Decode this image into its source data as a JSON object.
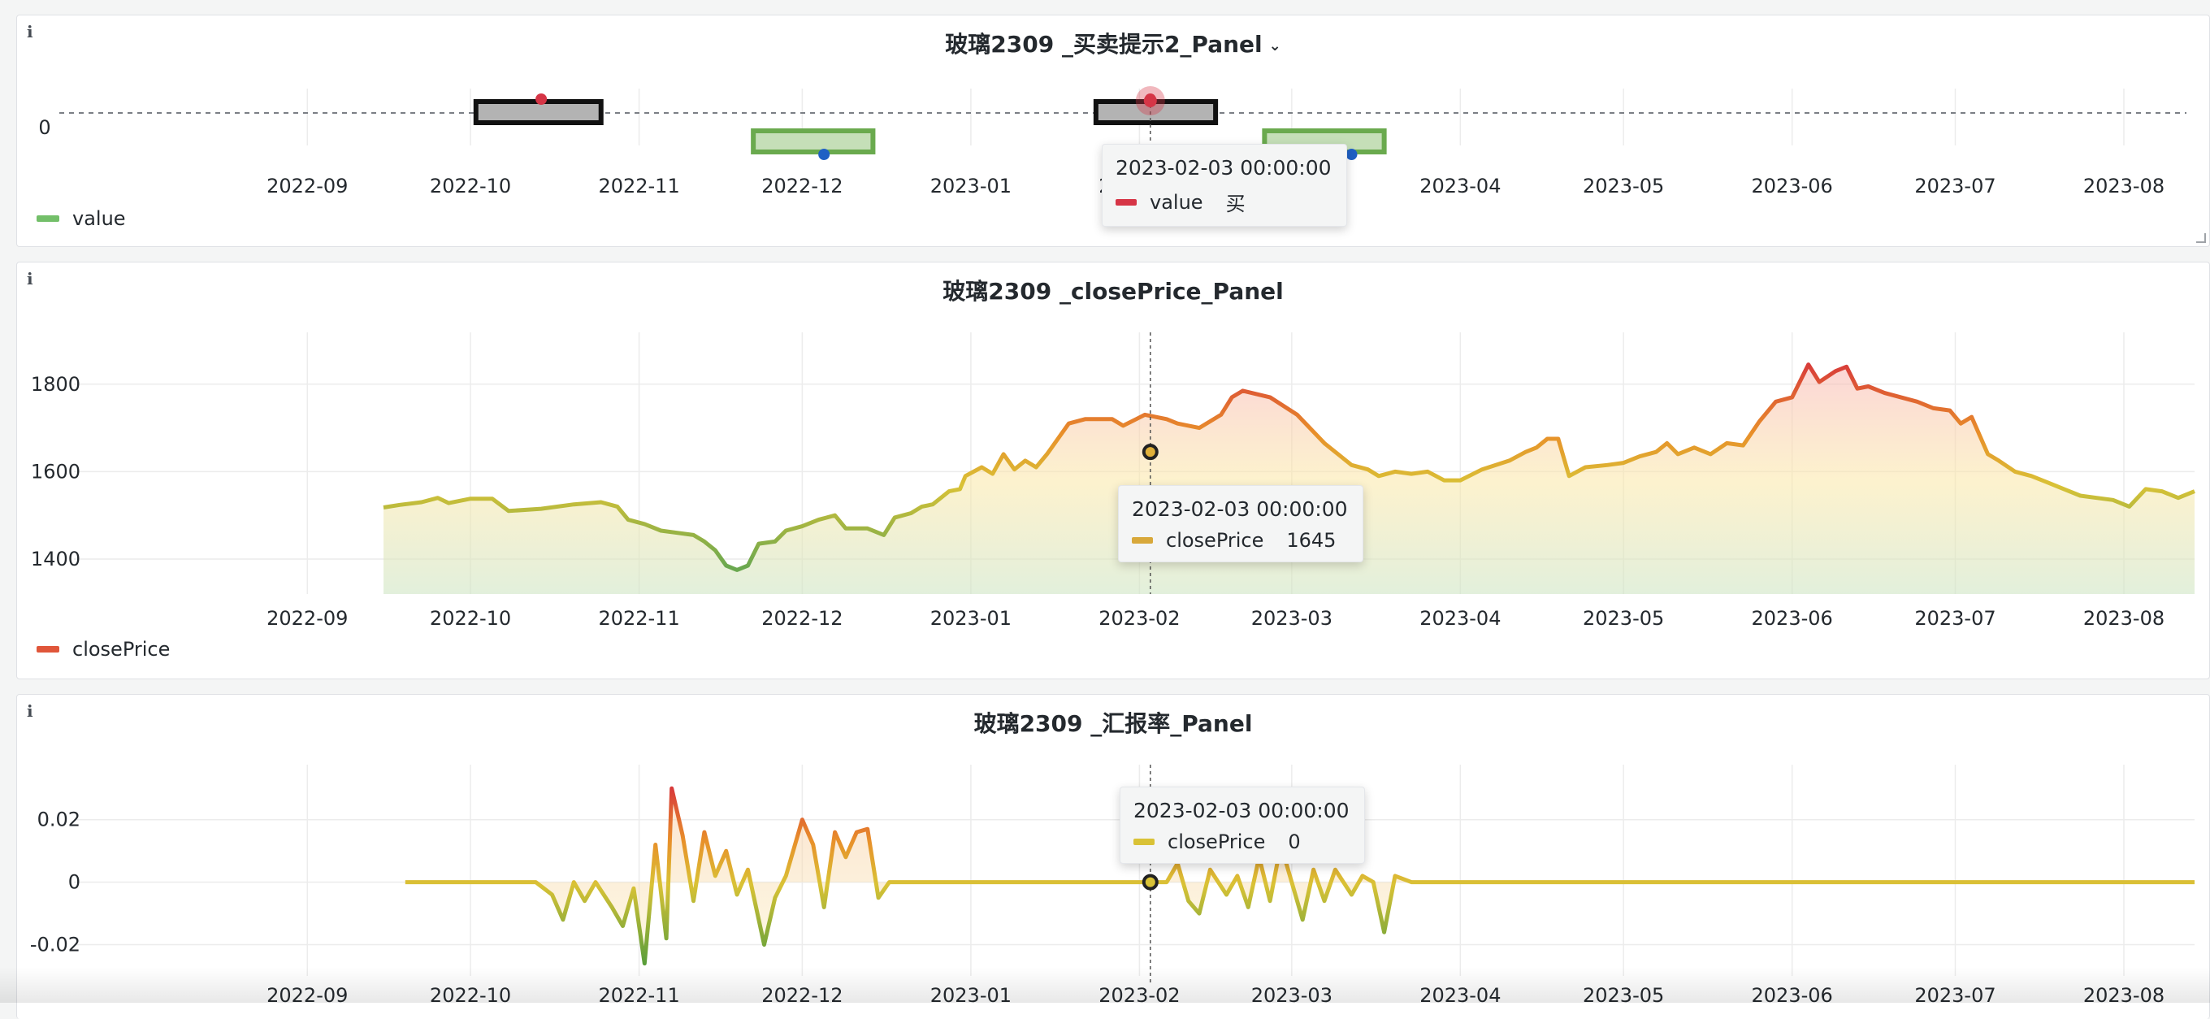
{
  "colors": {
    "buy": "#d63546",
    "sell": "#1f60c4",
    "buy_box": "#111111",
    "sell_box": "#6aaa4e",
    "legend_value": "#73bf69",
    "legend_close": "#e0563a",
    "tooltip_close": "#d8a83a",
    "tooltip_rate": "#d9c236"
  },
  "panels": [
    {
      "title": "玻璃2309 _买卖提示2_Panel",
      "info_icon": "info-icon",
      "chevron_icon": "chevron-down-icon",
      "legend": "value",
      "tooltip": {
        "time": "2023-02-03 00:00:00",
        "series": "value",
        "value": "买"
      }
    },
    {
      "title": "玻璃2309 _closePrice_Panel",
      "info_icon": "info-icon",
      "legend": "closePrice",
      "tooltip": {
        "time": "2023-02-03 00:00:00",
        "series": "closePrice",
        "value": "1645"
      }
    },
    {
      "title": "玻璃2309 _汇报率_Panel",
      "info_icon": "info-icon",
      "tooltip": {
        "time": "2023-02-03 00:00:00",
        "series": "closePrice",
        "value": "0"
      }
    }
  ],
  "chart_data": [
    {
      "type": "scatter",
      "title": "玻璃2309 _买卖提示2_Panel",
      "x_range": [
        "2022-08-10",
        "2023-08-14"
      ],
      "x_ticks": [
        "2022-09",
        "2022-10",
        "2022-11",
        "2022-12",
        "2023-01",
        "2023-02",
        "2023-03",
        "2023-04",
        "2023-05",
        "2023-06",
        "2023-07",
        "2023-08"
      ],
      "y_ticks": [
        "0"
      ],
      "ylim": [
        -1.2,
        1.2
      ],
      "signals": [
        {
          "date": "2022-10-14",
          "value": 1,
          "label": "买",
          "box": [
            "2022-10-02",
            "2022-10-25"
          ]
        },
        {
          "date": "2022-12-05",
          "value": -1,
          "label": "卖",
          "box": [
            "2022-11-22",
            "2022-12-14"
          ]
        },
        {
          "date": "2023-02-03",
          "value": 1,
          "label": "买",
          "box": [
            "2023-01-24",
            "2023-02-15"
          ]
        },
        {
          "date": "2023-03-12",
          "value": -1,
          "label": "卖",
          "box": [
            "2023-02-24",
            "2023-03-18"
          ]
        }
      ],
      "legend": [
        "value"
      ],
      "hover": {
        "date": "2023-02-03",
        "label": "买"
      }
    },
    {
      "type": "area",
      "title": "玻璃2309 _closePrice_Panel",
      "x_range": [
        "2022-08-10",
        "2023-08-14"
      ],
      "x_ticks": [
        "2022-09",
        "2022-10",
        "2022-11",
        "2022-12",
        "2023-01",
        "2023-02",
        "2023-03",
        "2023-04",
        "2023-05",
        "2023-06",
        "2023-07",
        "2023-08"
      ],
      "y_ticks": [
        "1400",
        "1600",
        "1800"
      ],
      "ylim": [
        1320,
        1900
      ],
      "series": [
        {
          "name": "closePrice",
          "points": [
            [
              "2022-09-15",
              1518
            ],
            [
              "2022-09-18",
              1524
            ],
            [
              "2022-09-22",
              1530
            ],
            [
              "2022-09-25",
              1540
            ],
            [
              "2022-09-27",
              1528
            ],
            [
              "2022-10-01",
              1538
            ],
            [
              "2022-10-05",
              1538
            ],
            [
              "2022-10-08",
              1510
            ],
            [
              "2022-10-14",
              1515
            ],
            [
              "2022-10-20",
              1525
            ],
            [
              "2022-10-25",
              1530
            ],
            [
              "2022-10-28",
              1520
            ],
            [
              "2022-10-30",
              1490
            ],
            [
              "2022-11-02",
              1480
            ],
            [
              "2022-11-05",
              1465
            ],
            [
              "2022-11-08",
              1460
            ],
            [
              "2022-11-11",
              1455
            ],
            [
              "2022-11-13",
              1440
            ],
            [
              "2022-11-15",
              1420
            ],
            [
              "2022-11-17",
              1385
            ],
            [
              "2022-11-19",
              1375
            ],
            [
              "2022-11-21",
              1385
            ],
            [
              "2022-11-23",
              1435
            ],
            [
              "2022-11-26",
              1440
            ],
            [
              "2022-11-28",
              1465
            ],
            [
              "2022-12-01",
              1475
            ],
            [
              "2022-12-04",
              1490
            ],
            [
              "2022-12-07",
              1500
            ],
            [
              "2022-12-09",
              1470
            ],
            [
              "2022-12-13",
              1470
            ],
            [
              "2022-12-16",
              1455
            ],
            [
              "2022-12-18",
              1495
            ],
            [
              "2022-12-21",
              1505
            ],
            [
              "2022-12-23",
              1520
            ],
            [
              "2022-12-25",
              1525
            ],
            [
              "2022-12-28",
              1555
            ],
            [
              "2022-12-30",
              1560
            ],
            [
              "2022-12-31",
              1590
            ],
            [
              "2023-01-03",
              1610
            ],
            [
              "2023-01-05",
              1595
            ],
            [
              "2023-01-07",
              1640
            ],
            [
              "2023-01-09",
              1605
            ],
            [
              "2023-01-11",
              1625
            ],
            [
              "2023-01-13",
              1610
            ],
            [
              "2023-01-15",
              1640
            ],
            [
              "2023-01-19",
              1710
            ],
            [
              "2023-01-22",
              1720
            ],
            [
              "2023-01-27",
              1720
            ],
            [
              "2023-01-29",
              1705
            ],
            [
              "2023-02-02",
              1730
            ],
            [
              "2023-02-06",
              1720
            ],
            [
              "2023-02-08",
              1710
            ],
            [
              "2023-02-12",
              1700
            ],
            [
              "2023-02-16",
              1730
            ],
            [
              "2023-02-18",
              1770
            ],
            [
              "2023-02-20",
              1785
            ],
            [
              "2023-02-25",
              1770
            ],
            [
              "2023-03-02",
              1730
            ],
            [
              "2023-03-07",
              1665
            ],
            [
              "2023-03-09",
              1645
            ],
            [
              "2023-03-12",
              1615
            ],
            [
              "2023-03-15",
              1605
            ],
            [
              "2023-03-17",
              1590
            ],
            [
              "2023-03-20",
              1600
            ],
            [
              "2023-03-23",
              1595
            ],
            [
              "2023-03-26",
              1600
            ],
            [
              "2023-03-29",
              1580
            ],
            [
              "2023-04-01",
              1580
            ],
            [
              "2023-04-05",
              1605
            ],
            [
              "2023-04-10",
              1625
            ],
            [
              "2023-04-13",
              1645
            ],
            [
              "2023-04-15",
              1655
            ],
            [
              "2023-04-17",
              1675
            ],
            [
              "2023-04-19",
              1675
            ],
            [
              "2023-04-21",
              1590
            ],
            [
              "2023-04-24",
              1610
            ],
            [
              "2023-04-28",
              1615
            ],
            [
              "2023-05-01",
              1620
            ],
            [
              "2023-05-04",
              1635
            ],
            [
              "2023-05-07",
              1645
            ],
            [
              "2023-05-09",
              1665
            ],
            [
              "2023-05-11",
              1640
            ],
            [
              "2023-05-14",
              1655
            ],
            [
              "2023-05-17",
              1640
            ],
            [
              "2023-05-20",
              1665
            ],
            [
              "2023-05-23",
              1660
            ],
            [
              "2023-05-26",
              1715
            ],
            [
              "2023-05-29",
              1760
            ],
            [
              "2023-06-01",
              1770
            ],
            [
              "2023-06-04",
              1845
            ],
            [
              "2023-06-06",
              1805
            ],
            [
              "2023-06-09",
              1830
            ],
            [
              "2023-06-11",
              1840
            ],
            [
              "2023-06-13",
              1790
            ],
            [
              "2023-06-15",
              1795
            ],
            [
              "2023-06-18",
              1780
            ],
            [
              "2023-06-21",
              1770
            ],
            [
              "2023-06-24",
              1760
            ],
            [
              "2023-06-27",
              1745
            ],
            [
              "2023-06-30",
              1740
            ],
            [
              "2023-07-02",
              1710
            ],
            [
              "2023-07-04",
              1725
            ],
            [
              "2023-07-07",
              1640
            ],
            [
              "2023-07-09",
              1625
            ],
            [
              "2023-07-12",
              1600
            ],
            [
              "2023-07-15",
              1590
            ],
            [
              "2023-07-18",
              1575
            ],
            [
              "2023-07-21",
              1560
            ],
            [
              "2023-07-24",
              1545
            ],
            [
              "2023-07-27",
              1540
            ],
            [
              "2023-07-30",
              1535
            ],
            [
              "2023-08-02",
              1520
            ],
            [
              "2023-08-05",
              1560
            ],
            [
              "2023-08-08",
              1555
            ],
            [
              "2023-08-11",
              1540
            ],
            [
              "2023-08-14",
              1555
            ]
          ]
        }
      ],
      "legend": [
        "closePrice"
      ],
      "hover": {
        "date": "2023-02-03",
        "value": 1645
      }
    },
    {
      "type": "line",
      "title": "玻璃2309 _汇报率_Panel",
      "x_range": [
        "2022-08-10",
        "2023-08-14"
      ],
      "x_ticks": [
        "2022-09",
        "2022-10",
        "2022-11",
        "2022-12",
        "2023-01",
        "2023-02",
        "2023-03",
        "2023-04",
        "2023-05",
        "2023-06",
        "2023-07",
        "2023-08"
      ],
      "y_ticks": [
        "0.02",
        "0",
        "-0.02"
      ],
      "ylim": [
        -0.03,
        0.035
      ],
      "series": [
        {
          "name": "closePrice",
          "points": [
            [
              "2022-09-19",
              0
            ],
            [
              "2022-10-13",
              0
            ],
            [
              "2022-10-16",
              -0.004
            ],
            [
              "2022-10-18",
              -0.012
            ],
            [
              "2022-10-20",
              0
            ],
            [
              "2022-10-22",
              -0.006
            ],
            [
              "2022-10-24",
              0
            ],
            [
              "2022-10-27",
              -0.008
            ],
            [
              "2022-10-29",
              -0.014
            ],
            [
              "2022-10-31",
              -0.002
            ],
            [
              "2022-11-02",
              -0.026
            ],
            [
              "2022-11-04",
              0.012
            ],
            [
              "2022-11-06",
              -0.018
            ],
            [
              "2022-11-07",
              0.03
            ],
            [
              "2022-11-09",
              0.015
            ],
            [
              "2022-11-11",
              -0.006
            ],
            [
              "2022-11-13",
              0.016
            ],
            [
              "2022-11-15",
              0.002
            ],
            [
              "2022-11-17",
              0.01
            ],
            [
              "2022-11-19",
              -0.004
            ],
            [
              "2022-11-21",
              0.004
            ],
            [
              "2022-11-24",
              -0.02
            ],
            [
              "2022-11-26",
              -0.005
            ],
            [
              "2022-11-28",
              0.002
            ],
            [
              "2022-12-01",
              0.02
            ],
            [
              "2022-12-03",
              0.012
            ],
            [
              "2022-12-05",
              -0.008
            ],
            [
              "2022-12-07",
              0.016
            ],
            [
              "2022-12-09",
              0.008
            ],
            [
              "2022-12-11",
              0.016
            ],
            [
              "2022-12-13",
              0.017
            ],
            [
              "2022-12-15",
              -0.005
            ],
            [
              "2022-12-17",
              0
            ],
            [
              "2023-01-28",
              0
            ],
            [
              "2023-02-06",
              0
            ],
            [
              "2023-02-08",
              0.006
            ],
            [
              "2023-02-10",
              -0.006
            ],
            [
              "2023-02-12",
              -0.01
            ],
            [
              "2023-02-14",
              0.004
            ],
            [
              "2023-02-17",
              -0.004
            ],
            [
              "2023-02-19",
              0.002
            ],
            [
              "2023-02-21",
              -0.008
            ],
            [
              "2023-02-23",
              0.008
            ],
            [
              "2023-02-25",
              -0.006
            ],
            [
              "2023-02-27",
              0.012
            ],
            [
              "2023-03-01",
              0
            ],
            [
              "2023-03-03",
              -0.012
            ],
            [
              "2023-03-05",
              0.004
            ],
            [
              "2023-03-07",
              -0.006
            ],
            [
              "2023-03-09",
              0.004
            ],
            [
              "2023-03-12",
              -0.004
            ],
            [
              "2023-03-14",
              0.002
            ],
            [
              "2023-03-16",
              0
            ],
            [
              "2023-03-18",
              -0.016
            ],
            [
              "2023-03-20",
              0.002
            ],
            [
              "2023-03-23",
              0
            ],
            [
              "2023-08-14",
              0
            ]
          ]
        }
      ],
      "hover": {
        "date": "2023-02-03",
        "value": 0
      }
    }
  ]
}
